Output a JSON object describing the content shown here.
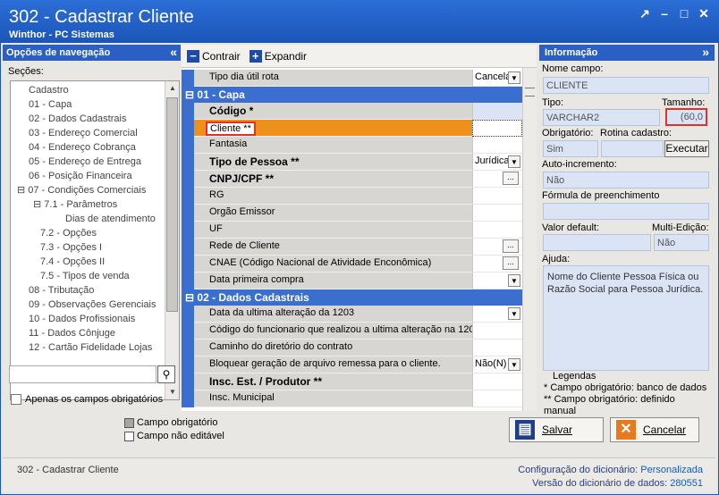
{
  "window": {
    "title": "302 - Cadastrar Cliente",
    "subtitle": "Winthor - PC Sistemas",
    "buttons": [
      "↗",
      "–",
      "□",
      "✕"
    ]
  },
  "left_panel": {
    "title": "Opções de navegação",
    "collapse_icon": "«",
    "sections_label": "Seções:",
    "tree": [
      {
        "label": "Cadastro",
        "indent": 0
      },
      {
        "label": "01 - Capa",
        "indent": 0
      },
      {
        "label": "02 - Dados Cadastrais",
        "indent": 0
      },
      {
        "label": "03 - Endereço Comercial",
        "indent": 0
      },
      {
        "label": "04 - Endereço Cobrança",
        "indent": 0
      },
      {
        "label": "05 - Endereço de Entrega",
        "indent": 0
      },
      {
        "label": "06 - Posição Financeira",
        "indent": 0
      },
      {
        "label": "⊟ 07 - Condições Comerciais",
        "indent": 0
      },
      {
        "label": "⊟ 7.1 - Parâmetros",
        "indent": 1
      },
      {
        "label": "Dias de atendimento",
        "indent": 2
      },
      {
        "label": "7.2 - Opções",
        "indent": 1
      },
      {
        "label": "7.3 - Opções I",
        "indent": 1
      },
      {
        "label": "7.4 - Opções II",
        "indent": 1
      },
      {
        "label": "7.5 - Tipos de venda",
        "indent": 1
      },
      {
        "label": "08 - Tributação",
        "indent": 0
      },
      {
        "label": "09 - Observações Gerenciais",
        "indent": 0
      },
      {
        "label": "10 - Dados Profissionais",
        "indent": 0
      },
      {
        "label": "11 - Dados Cônjuge",
        "indent": 0
      },
      {
        "label": "12 - Cartão Fidelidade Lojas",
        "indent": 0
      }
    ],
    "required_only_label": "Apenas os campos obrigatórios"
  },
  "toolbar": {
    "collapse_label": "Contrair",
    "expand_label": "Expandir"
  },
  "grid": {
    "rows": [
      {
        "type": "field",
        "label": "Tipo dia útil rota",
        "bold": false,
        "value": "Cancela",
        "control": "dropdown",
        "value_bg": "white"
      },
      {
        "type": "section",
        "label": "⊟ 01 - Capa"
      },
      {
        "type": "field",
        "label": "Código *",
        "bold": true,
        "value": "",
        "control": "none",
        "value_bg": "blue"
      },
      {
        "type": "field",
        "label": "Cliente **",
        "bold": false,
        "value": "",
        "control": "none",
        "value_bg": "white",
        "selected": true
      },
      {
        "type": "field",
        "label": "Fantasia",
        "bold": false,
        "value": "",
        "control": "none",
        "value_bg": "white"
      },
      {
        "type": "field",
        "label": "Tipo de Pessoa **",
        "bold": true,
        "value": "Jurídica",
        "control": "dropdown",
        "value_bg": "white"
      },
      {
        "type": "field",
        "label": "CNPJ/CPF **",
        "bold": true,
        "value": "",
        "control": "ellipsis",
        "value_bg": "white"
      },
      {
        "type": "field",
        "label": "RG",
        "bold": false,
        "value": "",
        "control": "none",
        "value_bg": "white"
      },
      {
        "type": "field",
        "label": "Orgão Emissor",
        "bold": false,
        "value": "",
        "control": "none",
        "value_bg": "white"
      },
      {
        "type": "field",
        "label": "UF",
        "bold": false,
        "value": "",
        "control": "none",
        "value_bg": "white"
      },
      {
        "type": "field",
        "label": "Rede de Cliente",
        "bold": false,
        "value": "",
        "control": "ellipsis",
        "value_bg": "white"
      },
      {
        "type": "field",
        "label": "CNAE (Código Nacional de Atividade Enconômica)",
        "bold": false,
        "value": "",
        "control": "ellipsis",
        "value_bg": "white"
      },
      {
        "type": "field",
        "label": "Data primeira compra",
        "bold": false,
        "value": "",
        "control": "dropdown",
        "value_bg": "white"
      },
      {
        "type": "section",
        "label": "⊟ 02 - Dados Cadastrais"
      },
      {
        "type": "field",
        "label": "Data da ultima alteração da 1203",
        "bold": false,
        "value": "",
        "control": "dropdown",
        "value_bg": "white"
      },
      {
        "type": "field",
        "label": "Código do funcionario que realizou a ultima alteração na 120",
        "bold": false,
        "value": "",
        "control": "none",
        "value_bg": "white"
      },
      {
        "type": "field",
        "label": "Caminho do diretório do contrato",
        "bold": false,
        "value": "",
        "control": "none",
        "value_bg": "white"
      },
      {
        "type": "field",
        "label": "Bloquear geração de arquivo remessa para o cliente.",
        "bold": false,
        "value": "Não(N)",
        "control": "dropdown",
        "value_bg": "white"
      },
      {
        "type": "field",
        "label": "Insc. Est. / Produtor **",
        "bold": true,
        "value": "",
        "control": "none",
        "value_bg": "white"
      },
      {
        "type": "field",
        "label": "Insc. Municipal",
        "bold": false,
        "value": "",
        "control": "none",
        "value_bg": "white"
      }
    ]
  },
  "right_panel": {
    "title": "Informação",
    "collapse_icon": "»",
    "field_name_label": "Nome campo:",
    "field_name_value": "CLIENTE",
    "type_label": "Tipo:",
    "type_value": "VARCHAR2",
    "size_label": "Tamanho:",
    "size_value": "(60,0",
    "required_label": "Obrigatório:",
    "required_value": "Sim",
    "routine_label": "Rotina cadastro:",
    "execute_label": "Executar",
    "autoinc_label": "Auto-incremento:",
    "autoinc_value": "Não",
    "formula_label": "Fórmula de preenchimento",
    "default_label": "Valor default:",
    "multiedit_label": "Multi-Edição:",
    "multiedit_value": "Não",
    "help_label": "Ajuda:",
    "help_text": "Nome do Cliente Pessoa Física ou Razão Social para Pessoa Jurídica.",
    "legend_title": "Legendas",
    "legend_1": "* Campo obrigatório: banco de dados",
    "legend_2": "** Campo obrigatório: definido manual"
  },
  "legend": {
    "required_label": "Campo obrigatório",
    "readonly_label": "Campo não editável"
  },
  "actions": {
    "save_label": "Salvar",
    "cancel_label": "Cancelar"
  },
  "status": {
    "left": "302 - Cadastrar Cliente",
    "config_key": "Configuração do dicionário:",
    "config_value": "Personalizada",
    "version_key": "Versão do dicionário de dados:",
    "version_value": "280551"
  },
  "colors": {
    "titlebar": "#1c55b8",
    "section": "#3a6fcf",
    "selected_row": "#f0901c",
    "highlight_border": "#e0322b"
  }
}
